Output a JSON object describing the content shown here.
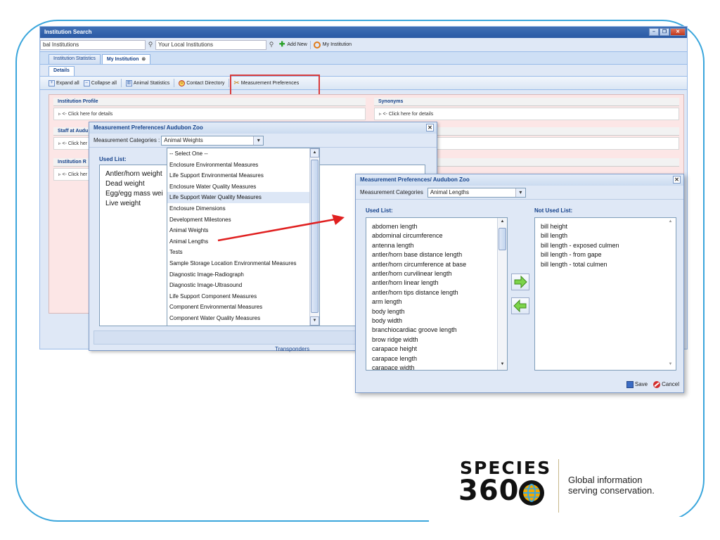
{
  "app": {
    "title": "Institution Search",
    "search_global": "bal Institutions",
    "search_local": "Your Local Institutions",
    "add_new": "Add New",
    "my_institution_link": "My Institution",
    "tabs": [
      "Institution Statistics",
      "My Institution"
    ],
    "subtab": "Details",
    "toolbar": {
      "expand_all": "Expand all",
      "collapse_all": "Collapse all",
      "animal_statistics": "Animal Statistics",
      "contact_directory": "Contact Directory",
      "measurement_preferences": "Measurement Preferences"
    },
    "panels": {
      "institution_profile": "Institution Profile",
      "synonyms": "Synonyms",
      "click_details": "<- Click here for details",
      "staff_at": "Staff at Audu",
      "click_short": "<- Click her",
      "institution_r": "Institution R"
    }
  },
  "dialog1": {
    "title": "Measurement Preferences/ Audubon Zoo",
    "category_label": "Measurement Categories :",
    "category_value": "Animal Weights",
    "used_list_label": "Used List:",
    "used_list": [
      "Antler/horn weight",
      "Dead weight",
      "Egg/egg mass wei",
      "Live weight"
    ],
    "dropdown_options": [
      "-- Select One --",
      "Enclosure Environmental Measures",
      "Life Support Environmental Measures",
      "Enclosure Water Quality Measures",
      "Life Support Water Quality Measures",
      "Enclosure Dimensions",
      "Development Milestones",
      "Animal Weights",
      "Animal Lengths",
      "Tests",
      "Sample Storage Location Environmental Measures",
      "Diagnostic Image-Radiograph",
      "Diagnostic Image-Ultrasound",
      "Life Support Component Measures",
      "Component Environmental Measures",
      "Component Water Quality Measures"
    ],
    "background_text": "Transponders"
  },
  "dialog2": {
    "title": "Measurement Preferences/ Audubon Zoo",
    "category_label": "Measurement Categories",
    "category_value": "Animal Lengths",
    "used_list_label": "Used List:",
    "not_used_list_label": "Not Used List:",
    "used_list": [
      "abdomen length",
      "abdominal circumference",
      "antenna length",
      "antler/horn base distance length",
      "antler/horn circumference at base",
      "antler/horn curvilinear length",
      "antler/horn linear length",
      "antler/horn tips distance length",
      "arm length",
      "body length",
      "body width",
      "branchiocardiac groove length",
      "brow ridge width",
      "carapace height",
      "carapace length",
      "carapace width"
    ],
    "not_used_list": [
      "bill height",
      "bill length",
      "bill length - exposed culmen",
      "bill length - from gape",
      "bill length - total culmen"
    ],
    "save_label": "Save",
    "cancel_label": "Cancel"
  },
  "logo": {
    "word1": "SPECIES",
    "word2": "360",
    "tagline_line1": "Global information",
    "tagline_line2": "serving conservation."
  },
  "colors": {
    "frame": "#3aa6dc",
    "highlight": "#d93b3b",
    "title_blue": "#15428b"
  }
}
